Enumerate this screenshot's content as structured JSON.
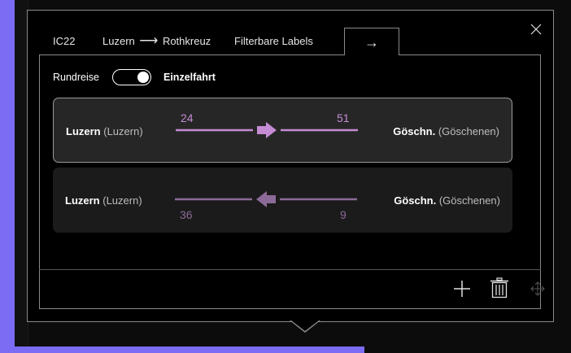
{
  "dialog": {
    "tabs": [
      {
        "label": "IC22"
      },
      {
        "from": "Luzern",
        "to": "Rothkreuz",
        "arrow": "⟶"
      },
      {
        "label": "Filterbare Labels"
      },
      {
        "label": "→"
      }
    ],
    "active_tab": 3
  },
  "toggle": {
    "left_label": "Rundreise",
    "right_label": "Einzelfahrt",
    "state": "Einzelfahrt"
  },
  "routes": [
    {
      "from_name": "Luzern",
      "from_full": "(Luzern)",
      "to_name": "Göschn.",
      "to_full": "(Göschenen)",
      "left_value": "24",
      "right_value": "51",
      "direction": "forward"
    },
    {
      "from_name": "Luzern",
      "from_full": "(Luzern)",
      "to_name": "Göschn.",
      "to_full": "(Göschenen)",
      "left_value": "36",
      "right_value": "9",
      "direction": "backward"
    }
  ],
  "colors": {
    "accent_active": "#c58bd4",
    "accent_inactive": "#8c6a97",
    "background_purple": "#7b6cf3"
  },
  "icons": {
    "close": "close-icon",
    "add": "plus-icon",
    "delete": "trash-icon",
    "move": "move-icon"
  }
}
